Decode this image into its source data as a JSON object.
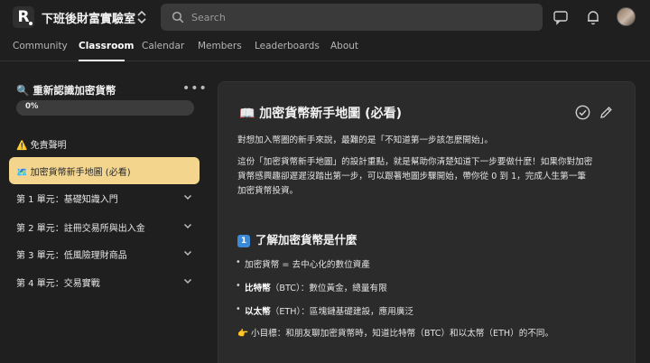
{
  "header": {
    "logo_letter": "R",
    "group_name": "下班後財富實驗室",
    "search_placeholder": "Search"
  },
  "nav": {
    "tabs": [
      {
        "label": "Community",
        "active": false
      },
      {
        "label": "Classroom",
        "active": true
      },
      {
        "label": "Calendar",
        "active": false
      },
      {
        "label": "Members",
        "active": false
      },
      {
        "label": "Leaderboards",
        "active": false
      },
      {
        "label": "About",
        "active": false
      }
    ]
  },
  "sidebar": {
    "course_icon": "🔍",
    "course_title": "重新認識加密貨幣",
    "progress_text": "0%",
    "progress_value": 0,
    "items": [
      {
        "label": "⚠️ 免責聲明",
        "active": false,
        "expandable": false
      },
      {
        "label": "🗺️ 加密貨幣新手地圖 (必看)",
        "active": true,
        "expandable": false
      },
      {
        "label": "第 1 單元：基礎知識入門",
        "active": false,
        "expandable": true
      },
      {
        "label": "第 2 單元：註冊交易所與出入金",
        "active": false,
        "expandable": true
      },
      {
        "label": "第 3 單元：低風險理財商品",
        "active": false,
        "expandable": true
      },
      {
        "label": "第 4 單元：交易實戰",
        "active": false,
        "expandable": true
      }
    ]
  },
  "lesson": {
    "title": "📖 加密貨幣新手地圖 (必看)",
    "para1": "對想加入幣圈的新手來說，最難的是「不知道第一步該怎麼開始」。",
    "para2_line1": "這份「加密貨幣新手地圖」的設計重點，就是幫助你清楚知道下一步要做什麼！如果你對加密",
    "para2_line2": "貨幣感興趣卻遲遲沒踏出第一步，可以跟著地圖步驟開始，帶你從 0 到 1，完成人生第一筆",
    "para2_line3": "加密貨幣投資。",
    "section_number": "1",
    "section_title": "了解加密貨幣是什麼",
    "bullets": [
      {
        "bold": "",
        "text": "加密貨幣 = 去中心化的數位資產"
      },
      {
        "bold": "比特幣",
        "text": "（BTC）：數位黃金，總量有限"
      },
      {
        "bold": "以太幣",
        "text": "（ETH）：區塊鏈基礎建設，應用廣泛"
      }
    ],
    "goal": "👉 小目標：和朋友聊加密貨幣時，知道比特幣（BTC）和以太幣（ETH）的不同。"
  },
  "colors": {
    "background": "#1f1f1f",
    "card": "#2b2b2b",
    "active_item": "#f3d58e",
    "search_bg": "#3a3a3a"
  }
}
